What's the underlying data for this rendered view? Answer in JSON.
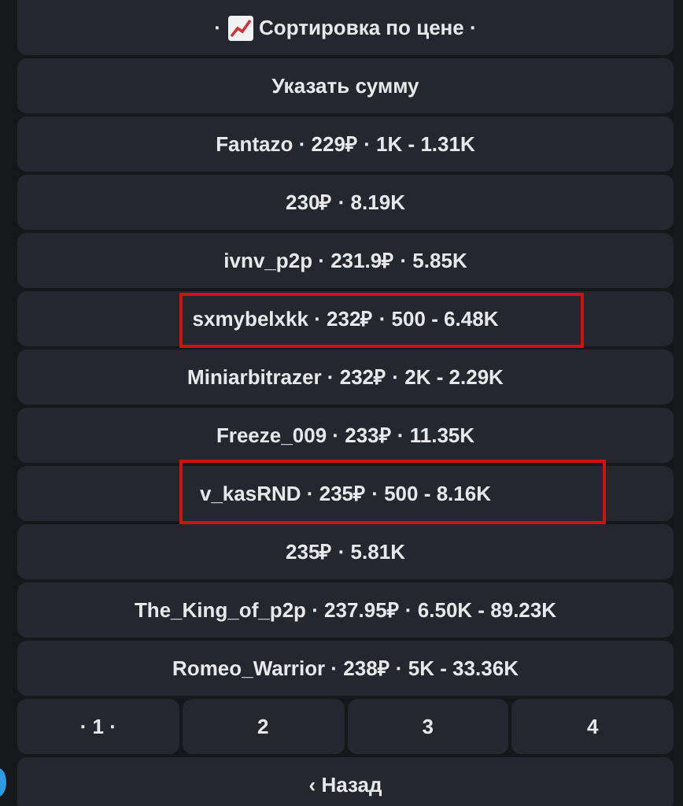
{
  "header": {
    "prefix": "·",
    "label": "Сортировка по цене ·"
  },
  "amount_button": "Указать сумму",
  "offers": [
    {
      "text": "Fantazo · 229₽ · 1K - 1.31K",
      "highlighted": false
    },
    {
      "text": "230₽ · 8.19K",
      "highlighted": false
    },
    {
      "text": "ivnv_p2p · 231.9₽ · 5.85K",
      "highlighted": false
    },
    {
      "text": "sxmybelxkk · 232₽ · 500 - 6.48K",
      "highlighted": true
    },
    {
      "text": "Miniarbitrazer · 232₽ · 2K - 2.29K",
      "highlighted": false
    },
    {
      "text": "Freeze_009 · 233₽ · 11.35K",
      "highlighted": false
    },
    {
      "text": "v_kasRND · 235₽ · 500 - 8.16K",
      "highlighted": true
    },
    {
      "text": "235₽ · 5.81K",
      "highlighted": false
    },
    {
      "text": "The_King_of_p2p · 237.95₽ · 6.50K - 89.23K",
      "highlighted": false
    },
    {
      "text": "Romeo_Warrior · 238₽ · 5K - 33.36K",
      "highlighted": false
    }
  ],
  "pages": [
    "· 1 ·",
    "2",
    "3",
    "4"
  ],
  "back_button": "‹ Назад"
}
